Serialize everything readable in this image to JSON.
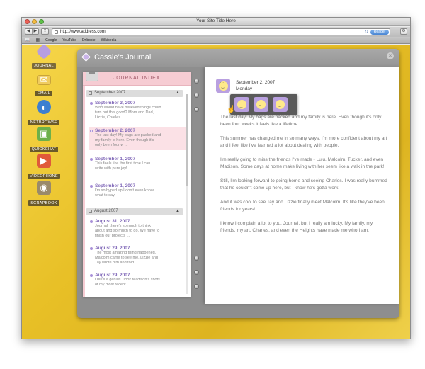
{
  "window": {
    "title": "Your Site Title Here",
    "url": "http://www.address.com",
    "reader_label": "Reader",
    "bookmarks": [
      "Google",
      "YouTube",
      "Dribbble",
      "Wikipedia"
    ]
  },
  "sidebar": {
    "items": [
      {
        "label": "JOURNAL",
        "icon": "journal-icon",
        "color": "#b79ee0"
      },
      {
        "label": "EMAIL",
        "icon": "envelope-icon",
        "color": "#f0cc60"
      },
      {
        "label": "NETBROWSE",
        "icon": "globe-icon",
        "color": "#3d7fd0"
      },
      {
        "label": "QUICKCHAT",
        "icon": "chat-icon",
        "color": "#6cb04a"
      },
      {
        "label": "VIDEOPHONE",
        "icon": "video-icon",
        "color": "#e05a3a"
      },
      {
        "label": "SCRAPBOOK",
        "icon": "camera-icon",
        "color": "#9a8a6a"
      }
    ]
  },
  "journal": {
    "title": "Cassie's Journal",
    "index_title": "JOURNAL INDEX",
    "months": [
      {
        "label": "September 2007",
        "entries": [
          {
            "date": "September 3, 2007",
            "lines": [
              "Who would have believed things could",
              "turn out this good? Mom and Dad,",
              "Lizzie, Charles ..."
            ]
          },
          {
            "date": "September 2, 2007",
            "lines": [
              "The last day! My bags are packed and",
              "my family is here.  Even though it's",
              "only been four w ..."
            ]
          },
          {
            "date": "September 1, 2007",
            "lines": [
              "This feels like the first time I can",
              "write with pure joy!"
            ]
          },
          {
            "date": "September 1, 2007",
            "lines": [
              "I'm so hyped up I don't even know",
              "what to say."
            ]
          }
        ]
      },
      {
        "label": "August 2007",
        "entries": [
          {
            "date": "August 31, 2007",
            "lines": [
              "Journal, there's so much to think",
              "about and so much to do. We have to",
              "finish our projects ..."
            ]
          },
          {
            "date": "August 29, 2007",
            "lines": [
              "The most amazing thing happened.",
              "Malcolm came to see me. Lizzie and",
              "Tay wrote him and told ..."
            ]
          },
          {
            "date": "August 29, 2007",
            "lines": [
              "Lulu's a genius. Took Madison's shots",
              "of my most recent ..."
            ]
          }
        ]
      }
    ],
    "entry": {
      "date": "September 2, 2007",
      "day": "Monday",
      "paragraphs": [
        "The last day! My bags are packed and my family is here.  Even though it's only been four weeks it feels like a lifetime.",
        "This summer has changed me in so many ways. I'm more confident about my art and I feel like I've learned a lot about dealing with people.",
        "I'm really going to miss the friends I've made - Lulu, Malcolm, Tucker, and even Madison. Some days at home make living with her seem like a walk in the park!",
        "Still, I'm looking forward to going home and seeing Charles. I was really bummed that he couldn't come up here, but I know he's gotta work.",
        "And it was cool to see Tay and Lizzie finally meet Malcolm. It's like they've been friends for years!",
        "I know I complain a lot to you, Journal, but I really am lucky. My family, my friends, my art, Charles, and even the Heights have made me who I am."
      ]
    },
    "moods": [
      "sad",
      "neutral",
      "happy"
    ]
  }
}
